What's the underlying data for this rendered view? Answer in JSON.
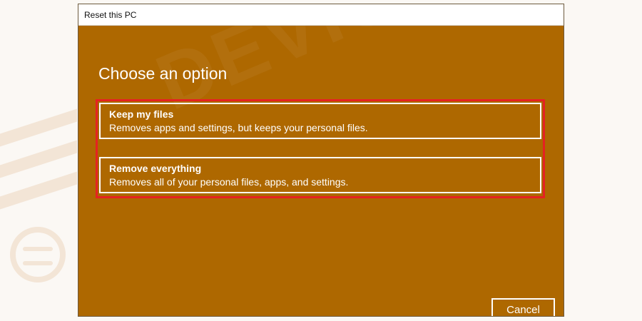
{
  "window": {
    "title": "Reset this PC"
  },
  "dialog": {
    "heading": "Choose an option",
    "options": [
      {
        "title": "Keep my files",
        "description": "Removes apps and settings, but keeps your personal files."
      },
      {
        "title": "Remove everything",
        "description": "Removes all of your personal files, apps, and settings."
      }
    ],
    "cancel_label": "Cancel"
  },
  "watermark": "DEVICETRICKS",
  "colors": {
    "dialog_background": "#ae6800",
    "highlight": "#e52222",
    "text": "#ffffff",
    "titlebar": "#ffffff"
  }
}
